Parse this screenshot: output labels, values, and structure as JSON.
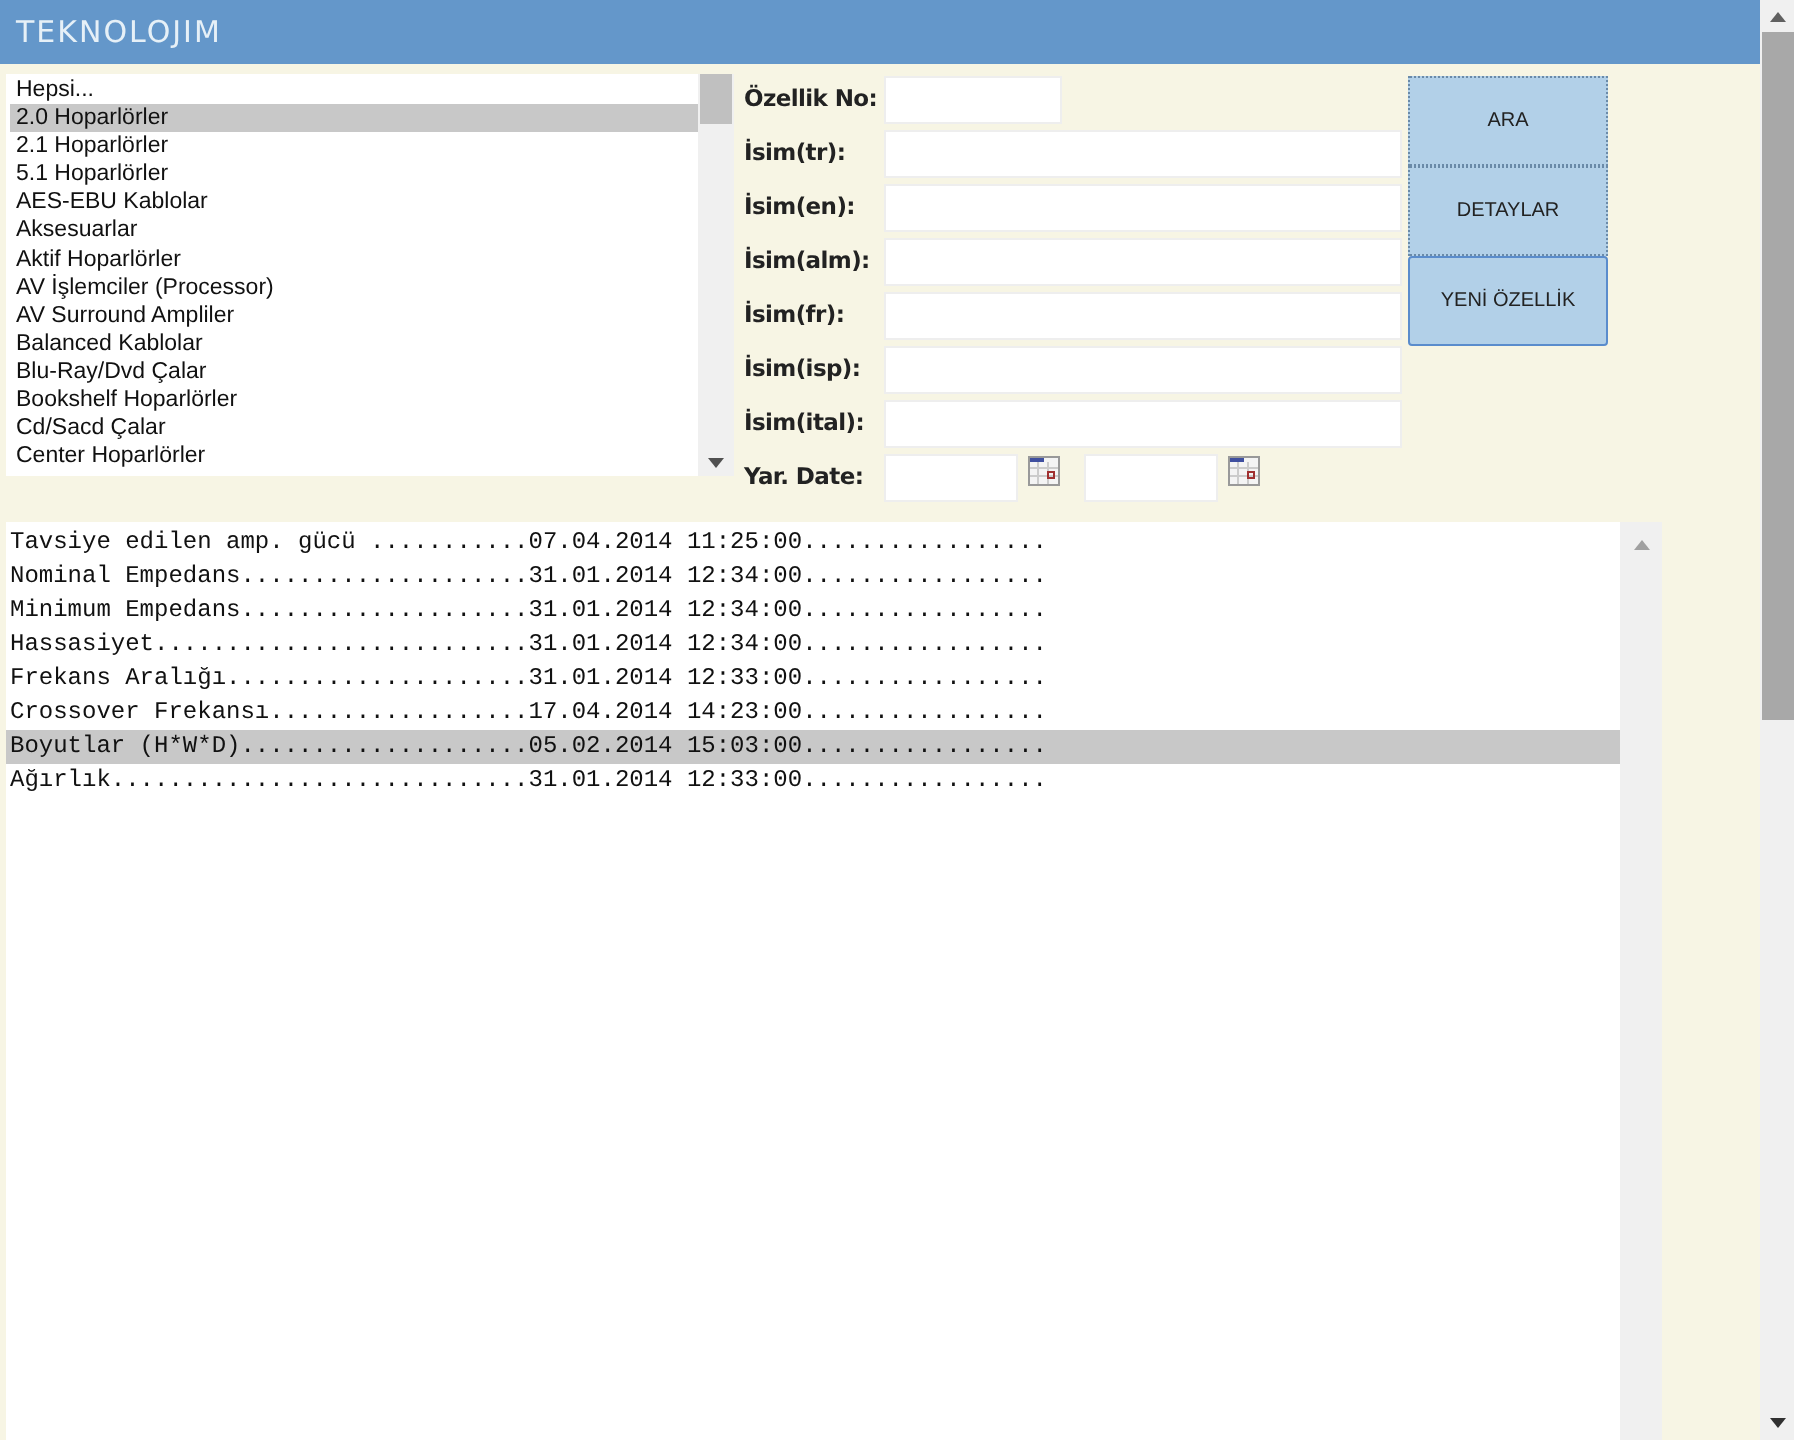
{
  "header": {
    "logo": "TEKNOLOJIM"
  },
  "categories": [
    {
      "label": "Hepsi...",
      "selected": false
    },
    {
      "label": "2.0 Hoparlörler",
      "selected": true
    },
    {
      "label": "2.1 Hoparlörler",
      "selected": false
    },
    {
      "label": "5.1 Hoparlörler",
      "selected": false
    },
    {
      "label": "AES-EBU Kablolar",
      "selected": false
    },
    {
      "label": "Aksesuarlar",
      "selected": false
    },
    {
      "label": "Aktif Hoparlörler",
      "selected": false
    },
    {
      "label": "AV İşlemciler (Processor)",
      "selected": false
    },
    {
      "label": "AV Surround Ampliler",
      "selected": false
    },
    {
      "label": "Balanced Kablolar",
      "selected": false
    },
    {
      "label": "Blu-Ray/Dvd Çalar",
      "selected": false
    },
    {
      "label": "Bookshelf Hoparlörler",
      "selected": false
    },
    {
      "label": "Cd/Sacd Çalar",
      "selected": false
    },
    {
      "label": "Center Hoparlörler",
      "selected": false
    }
  ],
  "form": {
    "fields": [
      {
        "label": "Özellik No:",
        "kind": "short"
      },
      {
        "label": "İsim(tr):",
        "kind": "wide"
      },
      {
        "label": "İsim(en):",
        "kind": "wide"
      },
      {
        "label": "İsim(alm):",
        "kind": "wide"
      },
      {
        "label": "İsim(fr):",
        "kind": "wide"
      },
      {
        "label": "İsim(isp):",
        "kind": "wide"
      },
      {
        "label": "İsim(ital):",
        "kind": "wide"
      },
      {
        "label": "Yar. Date:",
        "kind": "daterange"
      }
    ]
  },
  "buttons": [
    {
      "label": "ARA",
      "selected": false
    },
    {
      "label": "DETAYLAR",
      "selected": false
    },
    {
      "label": "YENİ ÖZELLİK",
      "selected": true
    }
  ],
  "properties": [
    {
      "text": "Tavsiye edilen amp. gücü ...........07.04.2014 11:25:00.................",
      "selected": false
    },
    {
      "text": "Nominal Empedans....................31.01.2014 12:34:00.................",
      "selected": false
    },
    {
      "text": "Minimum Empedans....................31.01.2014 12:34:00.................",
      "selected": false
    },
    {
      "text": "Hassasiyet..........................31.01.2014 12:34:00.................",
      "selected": false
    },
    {
      "text": "Frekans Aralığı.....................31.01.2014 12:33:00.................",
      "selected": false
    },
    {
      "text": "Crossover Frekansı..................17.04.2014 14:23:00.................",
      "selected": false
    },
    {
      "text": "Boyutlar (H*W*D)....................05.02.2014 15:03:00.................",
      "selected": true
    },
    {
      "text": "Ağırlık.............................31.01.2014 12:33:00.................",
      "selected": false
    }
  ]
}
